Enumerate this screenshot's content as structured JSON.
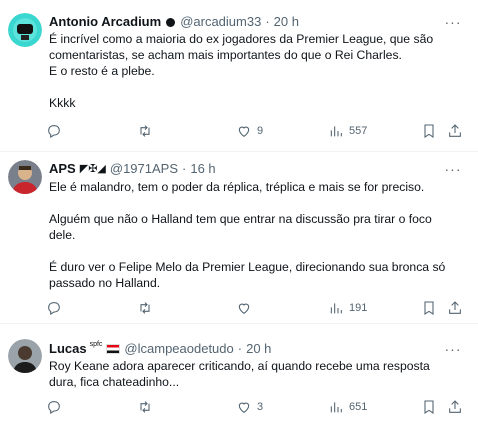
{
  "tweets": [
    {
      "name": "Antonio Arcadium",
      "handle": "@arcadium33",
      "sep": "·",
      "time": "20 h",
      "body": "É incrível como a maioria do ex jogadores da Premier League, que são comentaristas, se acham mais importantes do que o Rei Charles.\nE o resto é a plebe.\n\nKkkk",
      "replies": "",
      "reposts": "",
      "likes": "9",
      "views": "557"
    },
    {
      "name": "APS",
      "name_emojis": "◤✠◢",
      "handle": "@1971APS",
      "sep": "·",
      "time": "16 h",
      "body": "Ele é malandro, tem o poder da réplica, tréplica e mais se for preciso.\n\nAlguém que não o Halland tem que entrar na discussão pra tirar o foco dele.\n\nÉ duro ver o Felipe Melo da Premier League, direcionando sua bronca só passado no Halland.",
      "replies": "",
      "reposts": "",
      "likes": "",
      "views": "191"
    },
    {
      "name": "Lucas",
      "name_sup": "spfc",
      "handle": "@lcampeaodetudo",
      "sep": "·",
      "time": "20 h",
      "body": "Roy Keane adora aparecer criticando, aí quando recebe uma resposta dura, fica chateadinho...",
      "replies": "",
      "reposts": "",
      "likes": "3",
      "views": "651"
    }
  ],
  "icons": {
    "more": "more-horizontal-icon",
    "reply": "reply-icon",
    "repost": "repost-icon",
    "like": "heart-icon",
    "views": "views-chart-icon",
    "bookmark": "bookmark-icon",
    "share": "share-icon"
  },
  "colors": {
    "text": "#0f1419",
    "muted": "#536471",
    "divider": "#eff3f4"
  }
}
